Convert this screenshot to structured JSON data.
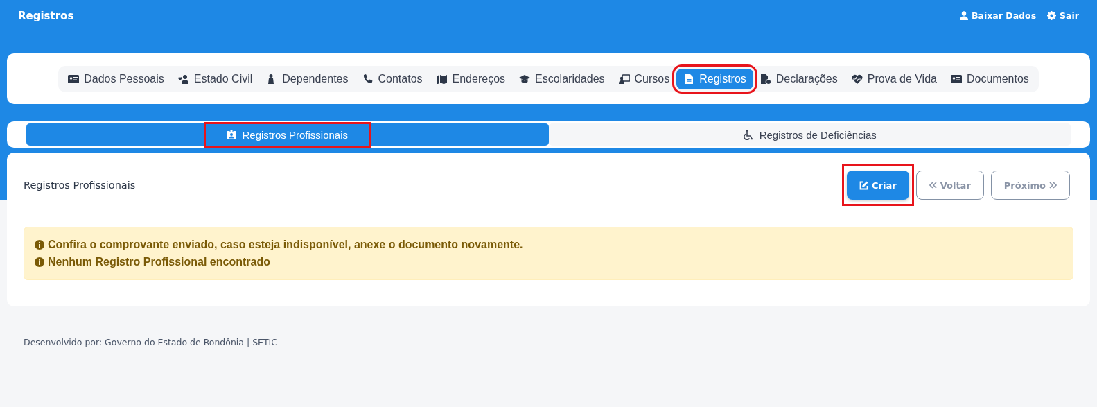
{
  "header": {
    "title": "Registros",
    "actions": [
      {
        "label": "Baixar Dados"
      },
      {
        "label": "Sair"
      }
    ]
  },
  "tabs": [
    {
      "label": "Dados Pessoais",
      "selected": false,
      "highlighted": false
    },
    {
      "label": "Estado Civil",
      "selected": false,
      "highlighted": false
    },
    {
      "label": "Dependentes",
      "selected": false,
      "highlighted": false
    },
    {
      "label": "Contatos",
      "selected": false,
      "highlighted": false
    },
    {
      "label": "Endereços",
      "selected": false,
      "highlighted": false
    },
    {
      "label": "Escolaridades",
      "selected": false,
      "highlighted": false
    },
    {
      "label": "Cursos",
      "selected": false,
      "highlighted": false
    },
    {
      "label": "Registros",
      "selected": true,
      "highlighted": true
    },
    {
      "label": "Declarações",
      "selected": false,
      "highlighted": false
    },
    {
      "label": "Prova de Vida",
      "selected": false,
      "highlighted": false
    },
    {
      "label": "Documentos",
      "selected": false,
      "highlighted": false
    }
  ],
  "subtabs": [
    {
      "label": "Registros Profissionais",
      "selected": true,
      "highlighted": true
    },
    {
      "label": "Registros de Deficiências",
      "selected": false,
      "highlighted": false
    }
  ],
  "panel": {
    "title": "Registros Profissionais",
    "buttons": [
      {
        "label": "Criar",
        "kind": "create",
        "disabled": false,
        "highlighted": true
      },
      {
        "label": "Voltar",
        "kind": "back",
        "disabled": true,
        "highlighted": false
      },
      {
        "label": "Próximo",
        "kind": "next",
        "disabled": true,
        "highlighted": false
      }
    ],
    "alerts": [
      "Confira o comprovante enviado, caso esteja indisponível, anexe o documento novamente.",
      "Nenhum Registro Profissional encontrado"
    ]
  },
  "footer": "Desenvolvido por: Governo do Estado de Rondônia | SETIC"
}
